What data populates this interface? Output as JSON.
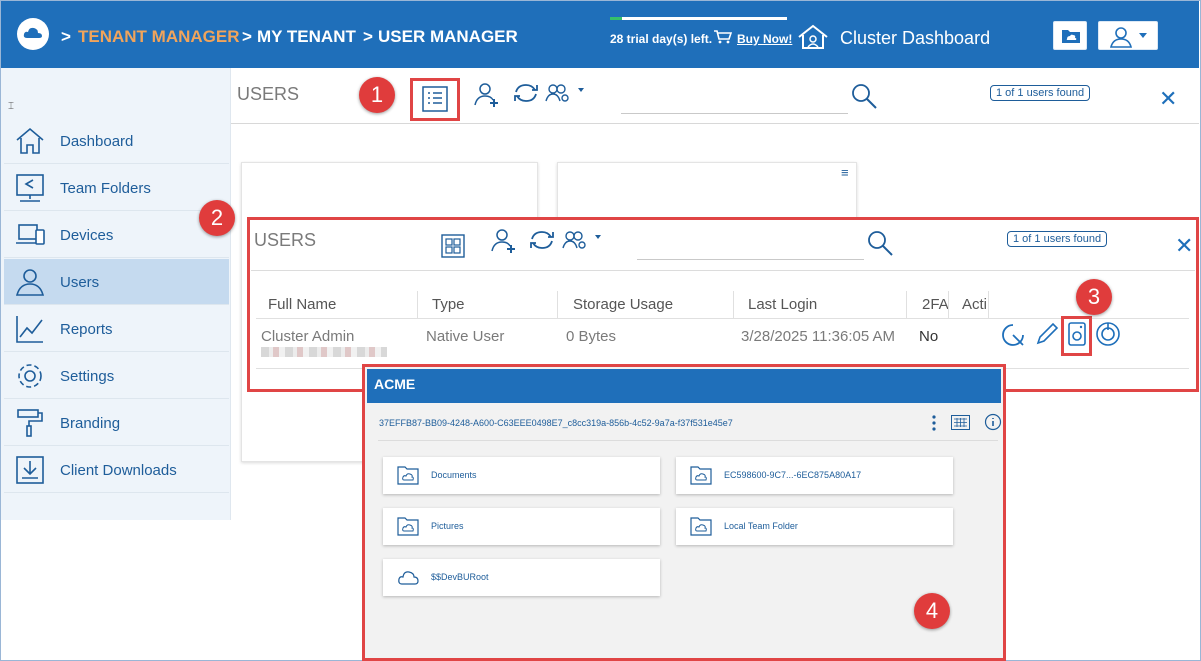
{
  "topbar": {
    "breadcrumb": [
      {
        "sep": ">",
        "label": "TENANT MANAGER"
      },
      {
        "sep": ">",
        "label": "MY TENANT"
      },
      {
        "sep": ">",
        "label": "USER MANAGER"
      }
    ],
    "trial_text": "28 trial day(s) left.",
    "buy_now": "Buy Now!",
    "cluster_dashboard": "Cluster Dashboard",
    "colors": {
      "bar": "#1f6fba",
      "crumb_accent": "#f1a45b"
    }
  },
  "sidebar": {
    "toggle_icon": "collapse-icon",
    "items": [
      {
        "label": "Dashboard",
        "icon": "home-icon"
      },
      {
        "label": "Team Folders",
        "icon": "team-folders-icon"
      },
      {
        "label": "Devices",
        "icon": "devices-icon"
      },
      {
        "label": "Users",
        "icon": "users-icon",
        "active": true
      },
      {
        "label": "Reports",
        "icon": "reports-icon"
      },
      {
        "label": "Settings",
        "icon": "gear-icon"
      },
      {
        "label": "Branding",
        "icon": "paint-roller-icon"
      },
      {
        "label": "Client Downloads",
        "icon": "download-icon"
      }
    ]
  },
  "users_view": {
    "title": "USERS",
    "found": "1 of 1 users found",
    "close": "✕"
  },
  "users_panel": {
    "title": "USERS",
    "found": "1 of 1 users found",
    "close": "✕",
    "columns": [
      "Full Name",
      "Type",
      "Storage Usage",
      "Last Login",
      "2FA",
      "Acti"
    ],
    "rows": [
      {
        "full_name": "Cluster Admin",
        "type": "Native User",
        "storage": "0 Bytes",
        "last_login": "3/28/2025 11:36:05 AM",
        "two_fa": "No"
      }
    ]
  },
  "storage_panel": {
    "title": "ACME",
    "id": "37EFFB87-BB09-4248-A600-C63EEE0498E7_c8cc319a-856b-4c52-9a7a-f37f531e45e7",
    "folders": [
      {
        "label": "Documents"
      },
      {
        "label": "EC598600-9C7...-6EC875A80A17"
      },
      {
        "label": "Pictures"
      },
      {
        "label": "Local Team Folder"
      },
      {
        "label": "$$DevBURoot"
      }
    ]
  },
  "callouts": [
    "1",
    "2",
    "3",
    "4"
  ],
  "highlight_color": "#e04545"
}
